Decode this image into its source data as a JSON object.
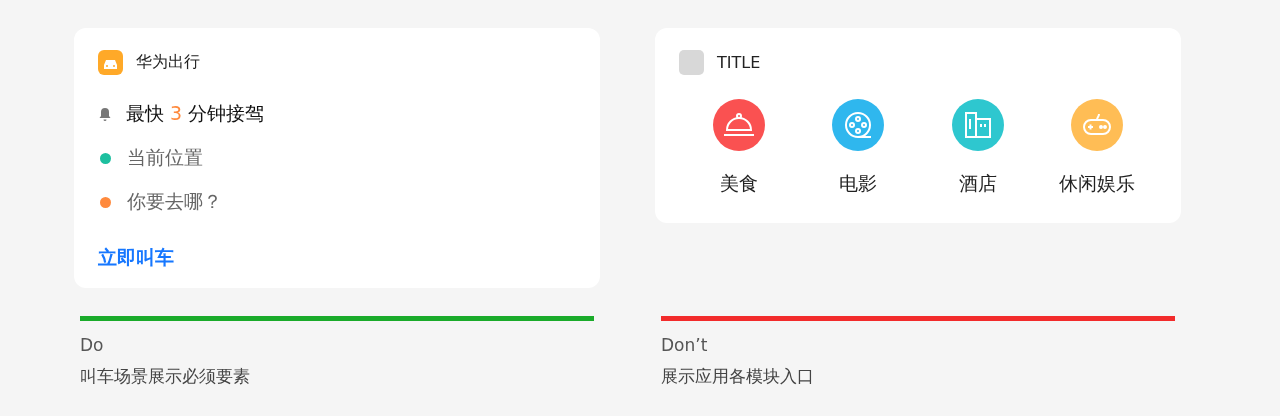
{
  "panels": [
    {
      "kind": "ride",
      "card": {
        "app_name": "华为出行",
        "eta": [
          {
            "text": "最快 ",
            "highlight": false
          },
          {
            "text": "3",
            "highlight": true
          },
          {
            "text": " 分钟接驾",
            "highlight": false
          }
        ],
        "places": [
          {
            "label": "当前位置",
            "color": "#1dbf9f"
          },
          {
            "label": "你要去哪？",
            "color": "#ff8a3d"
          }
        ],
        "action": "立即叫车"
      },
      "verdict": {
        "label": "Do",
        "color": "#1aab2a",
        "caption": "叫车场景展示必须要素"
      }
    },
    {
      "kind": "grid",
      "card": {
        "title": "TITLE",
        "entries": [
          {
            "label": "美食",
            "kind": "food",
            "color": "#fa5151"
          },
          {
            "label": "电影",
            "kind": "film",
            "color": "#2fb7ee"
          },
          {
            "label": "酒店",
            "kind": "hotel",
            "color": "#2ec7cf"
          },
          {
            "label": "休闲娱乐",
            "kind": "game",
            "color": "#ffbd55"
          }
        ]
      },
      "verdict": {
        "label": "Don’t",
        "color": "#f22b2b",
        "caption": "展示应用各模块入口"
      }
    }
  ]
}
